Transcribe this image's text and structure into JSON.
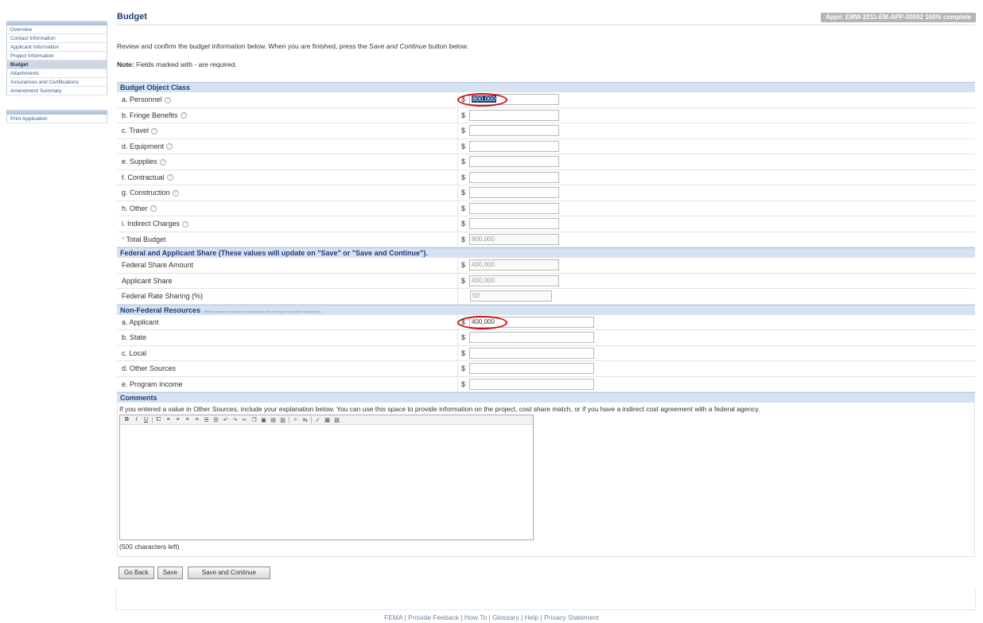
{
  "sidebar": {
    "items": [
      {
        "label": "Overview",
        "active": false
      },
      {
        "label": "Contact Information",
        "active": false
      },
      {
        "label": "Applicant Information",
        "active": false
      },
      {
        "label": "Project Information",
        "active": false
      },
      {
        "label": "Budget",
        "active": true
      },
      {
        "label": "Attachments",
        "active": false
      },
      {
        "label": "Assurances and Certifications",
        "active": false
      },
      {
        "label": "Amendment Summary",
        "active": false
      }
    ],
    "print_label": "Print Application"
  },
  "header": {
    "title": "Budget",
    "app_badge": "App#: EMW-2011-EM-APP-00092 100% complete"
  },
  "intro": {
    "before": "Review and confirm the budget information below. When you are finished, press the ",
    "emph": "Save and Continue",
    "after": " button below."
  },
  "note": {
    "label": "Note:",
    "text": " Fields marked with - are required."
  },
  "budget_object_class": {
    "heading": "Budget Object Class",
    "rows": [
      {
        "label": "a. Personnel",
        "value": "800,000"
      },
      {
        "label": "b. Fringe Benefits",
        "value": ""
      },
      {
        "label": "c. Travel",
        "value": ""
      },
      {
        "label": "d. Equipment",
        "value": ""
      },
      {
        "label": "e. Supplies",
        "value": ""
      },
      {
        "label": "f. Contractual",
        "value": ""
      },
      {
        "label": "g. Construction",
        "value": ""
      },
      {
        "label": "h. Other",
        "value": ""
      },
      {
        "label": "i. Indirect Charges",
        "value": ""
      }
    ],
    "total_label": "Total Budget",
    "total_value": "800,000"
  },
  "share": {
    "heading": "Federal and Applicant Share (These values will update on \"Save\" or \"Save and Continue\").",
    "federal_label": "Federal Share Amount",
    "federal_value": "400,000",
    "applicant_label": "Applicant Share",
    "applicant_value": "400,000",
    "rate_label": "Federal Rate Sharing (%)",
    "rate_value": "50"
  },
  "non_federal": {
    "heading": "Non-Federal Resources",
    "subnote": "(Please ensure combined non federal resources meet your cost share requirement)",
    "rows": [
      {
        "label": "a. Applicant",
        "value": "400,000"
      },
      {
        "label": "b. State",
        "value": ""
      },
      {
        "label": "c. Local",
        "value": ""
      },
      {
        "label": "d. Other Sources",
        "value": ""
      },
      {
        "label": "e. Program Income",
        "value": ""
      }
    ]
  },
  "comments": {
    "heading": "Comments",
    "instructions": "If you entered a value in Other Sources, include your explanation below. You can use this space to provide information on the project, cost share match, or if you have a indirect cost agreement with a federal agency.",
    "chars_left": "(500 characters left)",
    "toolbar": [
      "B",
      "I",
      "U"
    ]
  },
  "currency_symbol": "$",
  "buttons": {
    "go_back": "Go Back",
    "save": "Save",
    "save_continue": "Save and Continue"
  },
  "footer": {
    "links": [
      "FEMA",
      "Provide Feeback",
      "How To",
      "Glossary",
      "Help",
      "Privacy Statement"
    ],
    "separator": " | "
  },
  "colors": {
    "section_bg": "#d6e2f0",
    "title": "#1d3d7a",
    "annotation_ring": "#d01010",
    "badge_bg": "#b5b5b5"
  }
}
